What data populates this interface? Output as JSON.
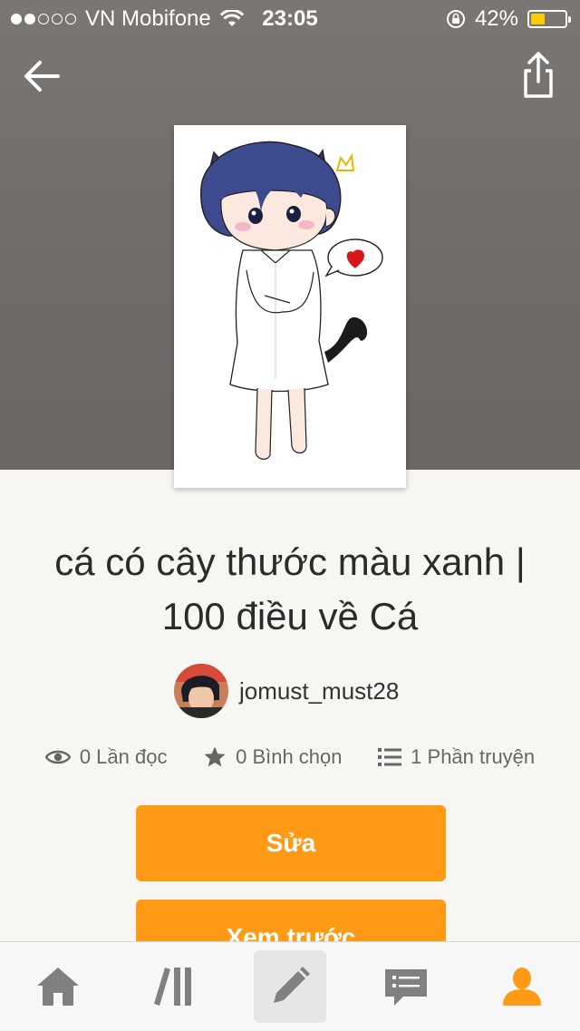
{
  "status_bar": {
    "signal_dots_filled": 2,
    "signal_dots_total": 5,
    "carrier": "VN Mobifone",
    "time": "23:05",
    "battery_percent_label": "42%",
    "battery_level": 0.42,
    "icons": [
      "wifi-icon",
      "orientation-lock-icon",
      "battery-icon"
    ]
  },
  "header": {
    "back_icon": "arrow-left-icon",
    "share_icon": "share-icon"
  },
  "story": {
    "title": "cá có cây thước màu xanh | 100 điều về Cá",
    "author": "jomust_must28"
  },
  "stats": {
    "reads": "0 Lần đọc",
    "votes": "0 Bình chọn",
    "parts": "1 Phần truyện"
  },
  "actions": {
    "edit_label": "Sửa",
    "preview_label": "Xem trước"
  },
  "tabbar": {
    "items": [
      {
        "name": "home",
        "icon": "home-icon"
      },
      {
        "name": "library",
        "icon": "library-icon"
      },
      {
        "name": "write",
        "icon": "pencil-icon",
        "active": true
      },
      {
        "name": "messages",
        "icon": "chat-icon"
      },
      {
        "name": "profile",
        "icon": "profile-icon"
      }
    ]
  },
  "colors": {
    "accent": "#ff9a16",
    "hero_background": "#716e6c",
    "page_background": "#f7f6f2",
    "battery_fill": "#ffcc00"
  }
}
